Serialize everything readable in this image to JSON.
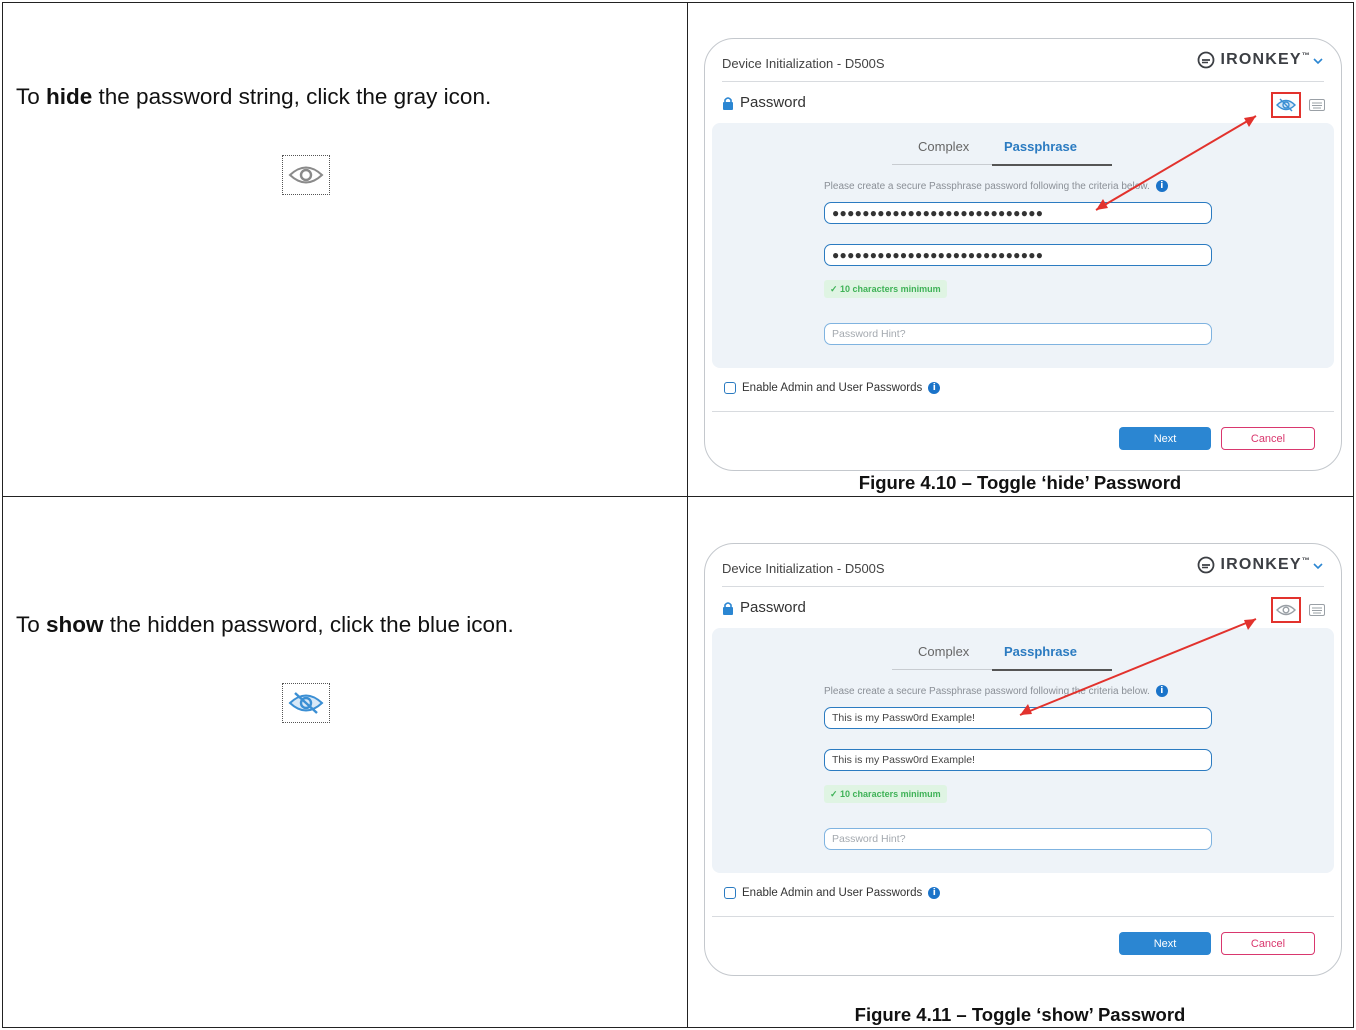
{
  "rows": [
    {
      "instruction_prefix": "To ",
      "instruction_bold": "hide",
      "instruction_suffix": " the password string, click the gray icon.",
      "icon_name": "eye-icon",
      "icon_color": "#8a8a8a",
      "dialog": {
        "title": "Device Initialization - D500S",
        "brand": "IRONKEY",
        "brand_mark": "™",
        "section_label": "Password",
        "tabs": [
          "Complex",
          "Passphrase"
        ],
        "active_tab": "Passphrase",
        "hint": "Please create a secure Passphrase password following the criteria below.",
        "password_field_1": "●●●●●●●●●●●●●●●●●●●●●●●●●●●●",
        "password_field_2": "●●●●●●●●●●●●●●●●●●●●●●●●●●●●",
        "requirement": "✓ 10 characters minimum",
        "hint_placeholder": "Password Hint?",
        "checkbox_label": "Enable Admin and User Passwords",
        "next_label": "Next",
        "cancel_label": "Cancel",
        "toggle_state": "hide"
      },
      "caption": "Figure 4.10 – Toggle ‘hide’ Password"
    },
    {
      "instruction_prefix": "To ",
      "instruction_bold": "show",
      "instruction_suffix": " the hidden password, click the blue icon.",
      "icon_name": "eye-slash-icon",
      "icon_color": "#3b8fd4",
      "dialog": {
        "title": "Device Initialization - D500S",
        "brand": "IRONKEY",
        "brand_mark": "™",
        "section_label": "Password",
        "tabs": [
          "Complex",
          "Passphrase"
        ],
        "active_tab": "Passphrase",
        "hint": "Please create a secure Passphrase password following the criteria below.",
        "password_field_1": "This is my Passw0rd Example!",
        "password_field_2": "This is my Passw0rd Example!",
        "requirement": "✓ 10 characters minimum",
        "hint_placeholder": "Password Hint?",
        "checkbox_label": "Enable Admin and User Passwords",
        "next_label": "Next",
        "cancel_label": "Cancel",
        "toggle_state": "show"
      },
      "caption": "Figure 4.11 – Toggle ‘show’ Password"
    }
  ],
  "colors": {
    "highlight_red": "#e2322d",
    "accent_blue": "#2b86d2",
    "cancel_pink": "#d9376e",
    "success_green": "#3fb257"
  }
}
